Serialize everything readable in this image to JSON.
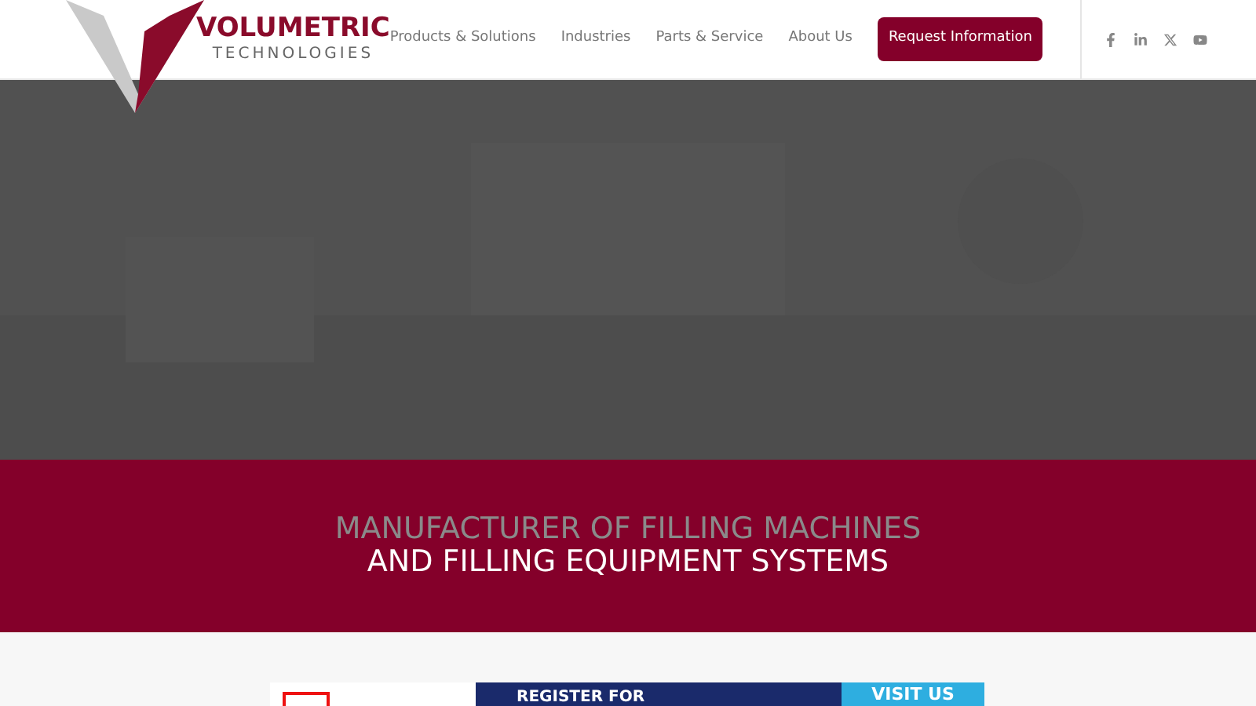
{
  "logo": {
    "name": "VOLUMETRIC",
    "tagline": "TECHNOLOGIES"
  },
  "nav": [
    {
      "label": "Products & Solutions",
      "kind": "link"
    },
    {
      "label": "Industries",
      "kind": "link"
    },
    {
      "label": "Parts & Service",
      "kind": "link"
    },
    {
      "label": "About Us",
      "kind": "link"
    },
    {
      "label": "Request Information",
      "kind": "button"
    }
  ],
  "social": [
    {
      "kind": "facebook"
    },
    {
      "kind": "linkedin"
    },
    {
      "kind": "x"
    },
    {
      "kind": "youtube"
    }
  ],
  "tagline": {
    "line_1": "MANUFACTURER OF FILLING MACHINES",
    "line_2": "AND FILLING EQUIPMENT SYSTEMS"
  },
  "banner": {
    "headline": "REGISTER FOR",
    "cta": "VISIT US"
  }
}
